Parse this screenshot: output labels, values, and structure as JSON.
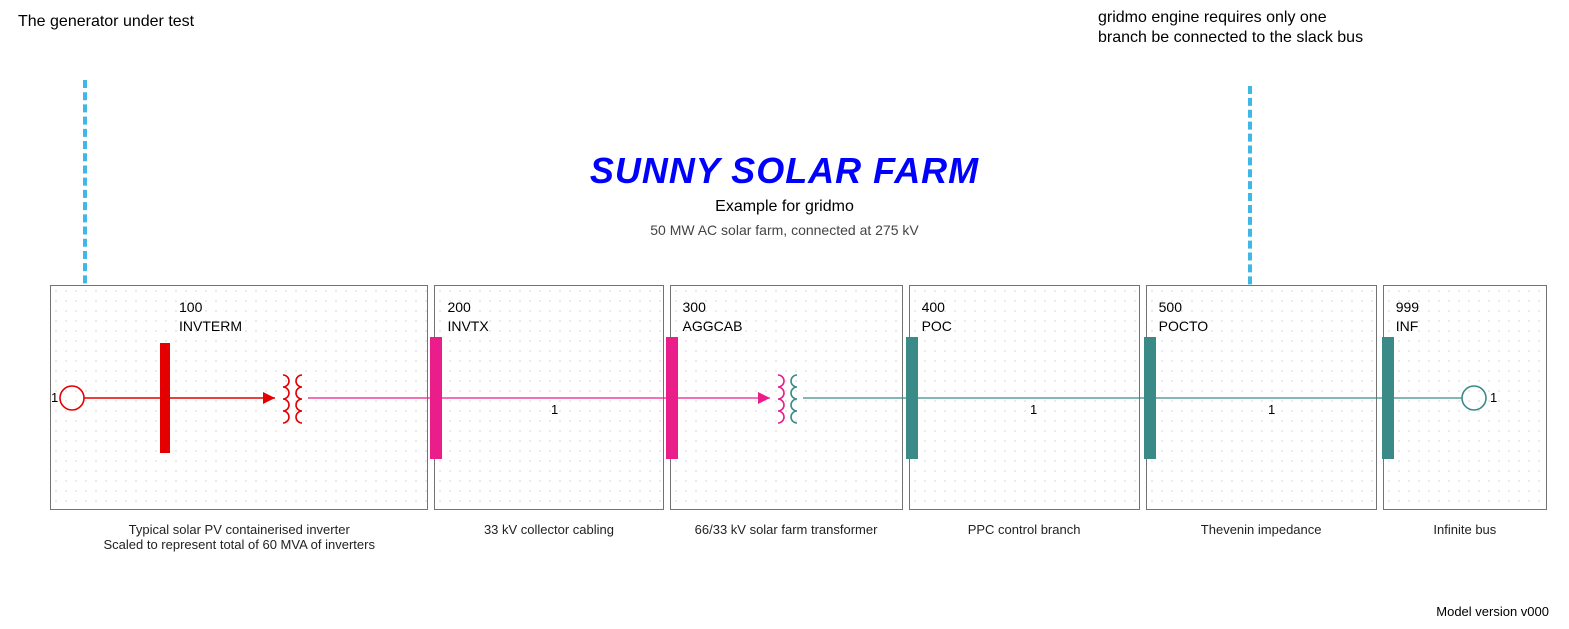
{
  "annotations": {
    "left": "The generator under test",
    "right": "gridmo engine requires only one branch be connected to the slack bus"
  },
  "title": {
    "main": "SUNNY SOLAR FARM",
    "sub1": "Example for gridmo",
    "sub2": "50 MW AC solar farm, connected at 275 kV"
  },
  "buses": [
    {
      "num": "100",
      "name": "INVTERM"
    },
    {
      "num": "200",
      "name": "INVTX"
    },
    {
      "num": "300",
      "name": "AGGCAB"
    },
    {
      "num": "400",
      "name": "POC"
    },
    {
      "num": "500",
      "name": "POCTO"
    },
    {
      "num": "999",
      "name": "INF"
    }
  ],
  "captions": [
    "Typical solar PV containerised inverter\nScaled to represent total of 60 MVA of inverters",
    "33 kV collector cabling",
    "66/33 kV solar farm transformer",
    "PPC control branch",
    "Thevenin impedance",
    "Infinite bus"
  ],
  "circuit_ids": {
    "c1": "1",
    "c2": "1",
    "c3": "1",
    "c4": "1"
  },
  "terminals": {
    "left": "1",
    "right": "1"
  },
  "version": "Model version v000"
}
